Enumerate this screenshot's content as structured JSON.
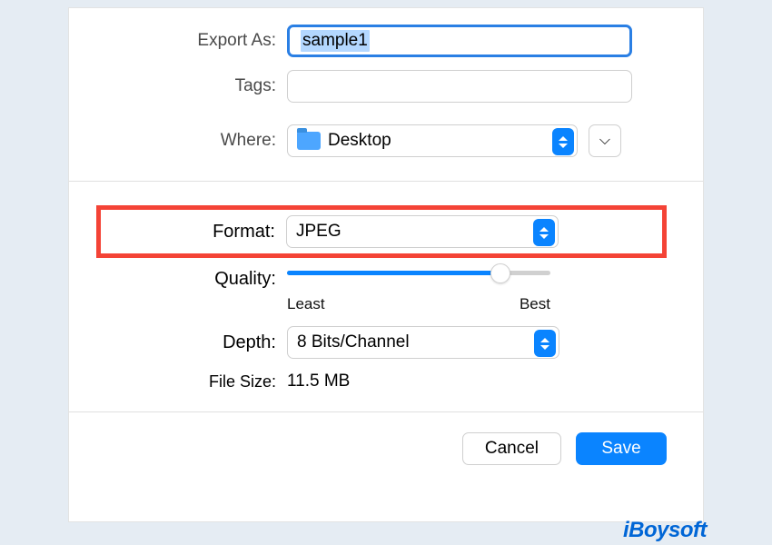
{
  "fields": {
    "exportAs": {
      "label": "Export As:",
      "value": "sample1"
    },
    "tags": {
      "label": "Tags:",
      "value": ""
    },
    "where": {
      "label": "Where:",
      "value": "Desktop",
      "icon": "folder-icon"
    },
    "format": {
      "label": "Format:",
      "value": "JPEG"
    },
    "quality": {
      "label": "Quality:",
      "minLabel": "Least",
      "maxLabel": "Best",
      "value": 81
    },
    "depth": {
      "label": "Depth:",
      "value": "8 Bits/Channel"
    },
    "fileSize": {
      "label": "File Size:",
      "value": "11.5 MB"
    }
  },
  "buttons": {
    "cancel": "Cancel",
    "save": "Save"
  },
  "watermark": "iBoysoft"
}
